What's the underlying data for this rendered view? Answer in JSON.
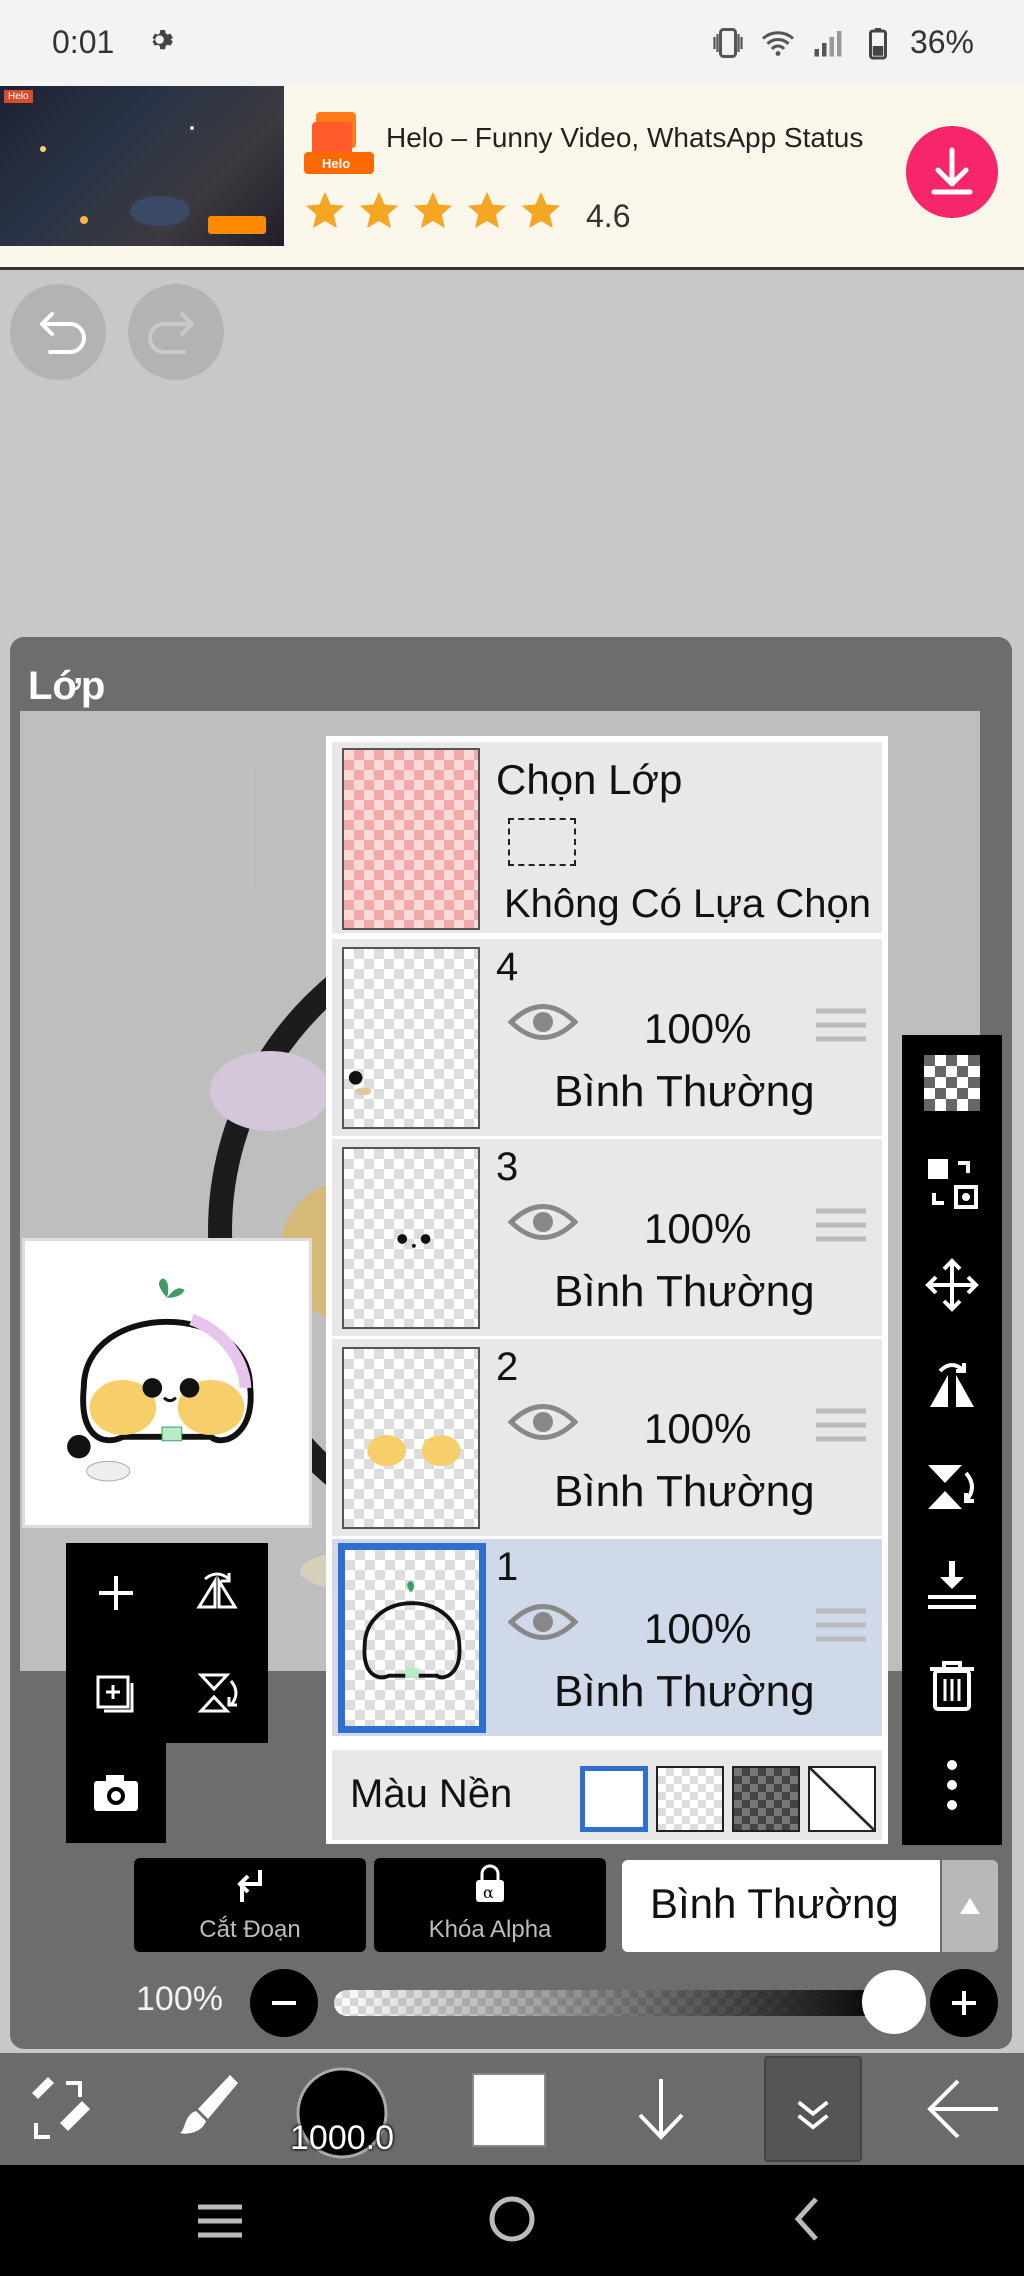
{
  "status_bar": {
    "time": "0:01",
    "battery": "36%"
  },
  "ad": {
    "app_title": "Helo – Funny Video, WhatsApp Status",
    "rating": "4.6",
    "stars": 5,
    "logo_text": "Helo",
    "image_tag": "Helo"
  },
  "panel": {
    "title": "Lớp"
  },
  "selection_layer": {
    "title": "Chọn Lớp",
    "status": "Không Có Lựa Chọn"
  },
  "layers": [
    {
      "number": "4",
      "opacity": "100%",
      "blend": "Bình Thường",
      "selected": false
    },
    {
      "number": "3",
      "opacity": "100%",
      "blend": "Bình Thường",
      "selected": false
    },
    {
      "number": "2",
      "opacity": "100%",
      "blend": "Bình Thường",
      "selected": false
    },
    {
      "number": "1",
      "opacity": "100%",
      "blend": "Bình Thường",
      "selected": true
    }
  ],
  "background": {
    "label": "Màu Nền"
  },
  "bottom_controls": {
    "clip_label": "Cắt Đoạn",
    "alpha_lock_label": "Khóa Alpha",
    "blend_mode": "Bình Thường",
    "opacity_label": "100%",
    "opacity_value": 1.0
  },
  "toolbar": {
    "brush_size": "1000.0"
  },
  "icons": {
    "accent": "#2f6fd0",
    "ad_download": "#f7266a",
    "star": "#f5a623"
  }
}
